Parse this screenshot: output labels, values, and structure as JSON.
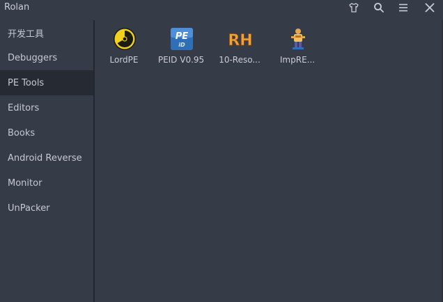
{
  "window": {
    "title": "Rolan"
  },
  "titlebar_icons": [
    "shirt-icon",
    "search-icon",
    "menu-icon",
    "close-icon"
  ],
  "sidebar": {
    "items": [
      {
        "label": "开发工具"
      },
      {
        "label": "Debuggers"
      },
      {
        "label": "PE Tools",
        "active": true
      },
      {
        "label": "Editors"
      },
      {
        "label": "Books"
      },
      {
        "label": "Android Reverse"
      },
      {
        "label": "Monitor"
      },
      {
        "label": "UnPacker"
      }
    ]
  },
  "tools": [
    {
      "label": "LordPE",
      "icon": "radiation-icon"
    },
    {
      "label": "PEID V0.95",
      "icon": "peid-icon"
    },
    {
      "label": "10-Reso...",
      "icon": "rh-icon"
    },
    {
      "label": "ImpRE...",
      "icon": "imprec-icon"
    }
  ],
  "colors": {
    "background": "#353b47",
    "sidebar_active": "#262a33",
    "text": "#c4c9d2"
  }
}
